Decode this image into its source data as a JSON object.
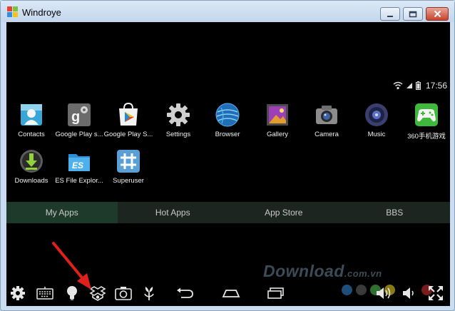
{
  "window": {
    "title": "Windroye"
  },
  "status": {
    "time": "17:56"
  },
  "apps": [
    {
      "label": "Contacts",
      "icon": "contacts-icon"
    },
    {
      "label": "Google Play s...",
      "icon": "google-settings-icon"
    },
    {
      "label": "Google Play S...",
      "icon": "play-store-icon"
    },
    {
      "label": "Settings",
      "icon": "settings-gear-icon"
    },
    {
      "label": "Browser",
      "icon": "browser-globe-icon"
    },
    {
      "label": "Gallery",
      "icon": "gallery-icon"
    },
    {
      "label": "Camera",
      "icon": "camera-icon"
    },
    {
      "label": "Music",
      "icon": "music-speaker-icon"
    },
    {
      "label": "360手机游戏",
      "icon": "gamepad-icon"
    },
    {
      "label": "Downloads",
      "icon": "downloads-icon"
    },
    {
      "label": "ES File Explor...",
      "icon": "es-file-explorer-icon"
    },
    {
      "label": "Superuser",
      "icon": "superuser-icon"
    }
  ],
  "tabs": [
    {
      "label": "My Apps",
      "active": true
    },
    {
      "label": "Hot Apps",
      "active": false
    },
    {
      "label": "App Store",
      "active": false
    },
    {
      "label": "BBS",
      "active": false
    }
  ],
  "watermark": {
    "text": "Download",
    "suffix": ".com.vn"
  },
  "colors": {
    "accent_tab": "#1e3a2a",
    "arrow": "#e0201b",
    "screen_bg": "#000000"
  }
}
